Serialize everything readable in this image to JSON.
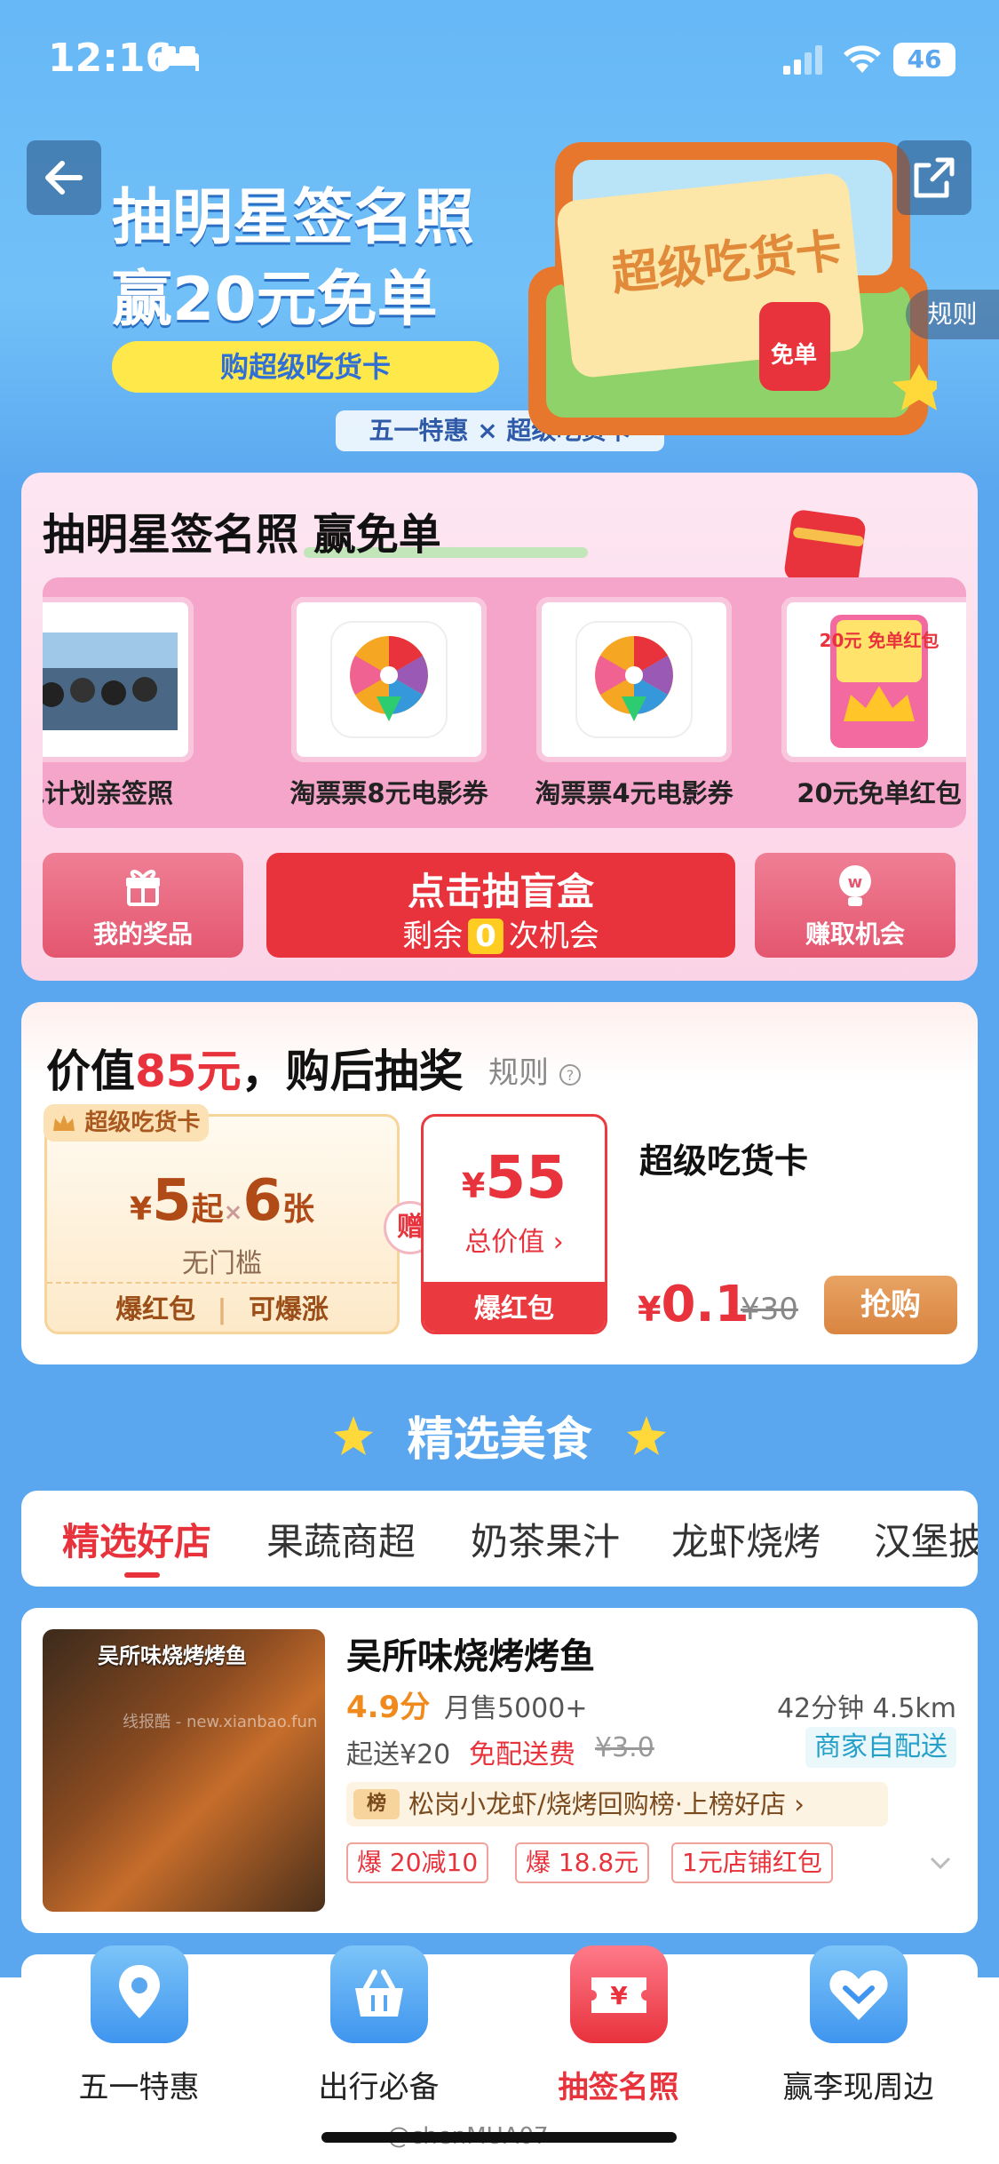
{
  "status_bar": {
    "time": "12:16",
    "battery": "46"
  },
  "hero": {
    "title_line1": "抽明星签名照",
    "title_line2": "赢20元免单",
    "pill": "购超级吃货卡",
    "tag": "五一特惠 × 超级吃货卡",
    "card_text": "超级吃货卡",
    "redbag_text": "免单",
    "rules": "规则"
  },
  "lottery": {
    "title": "抽明星签名照 赢免单",
    "prizes": [
      {
        "label": "跑计划亲签照"
      },
      {
        "label": "淘票票8元电影券"
      },
      {
        "label": "淘票票4元电影券"
      },
      {
        "label": "20元免单红包",
        "badge": "20元 免单红包"
      }
    ],
    "my_prizes": "我的奖品",
    "draw_title": "点击抽盲盒",
    "draw_remaining_prefix": "剩余",
    "draw_remaining_count": "0",
    "draw_remaining_suffix": "次机会",
    "earn": "赚取机会"
  },
  "value_card": {
    "head_prefix": "价值",
    "head_value": "85元",
    "head_suffix": "，购后抽奖",
    "rule": "规则",
    "coupon1": {
      "badge": "超级吃货卡",
      "currency": "¥",
      "from": "5",
      "from_suffix": "起",
      "times": "×",
      "count": "6",
      "count_suffix": "张",
      "threshold": "无门槛",
      "foot_left": "爆红包",
      "foot_right": "可爆涨"
    },
    "gift": "赠",
    "coupon2": {
      "currency": "¥",
      "amount": "55",
      "sub": "总价值",
      "foot": "爆红包"
    },
    "product_name": "超级吃货卡",
    "price_currency": "¥",
    "price_now": "0.1",
    "price_old": "¥30",
    "buy": "抢购"
  },
  "section_title": "精选美食",
  "tabs": [
    {
      "label": "精选好店",
      "active": true
    },
    {
      "label": "果蔬商超"
    },
    {
      "label": "奶茶果汁"
    },
    {
      "label": "龙虾烧烤"
    },
    {
      "label": "汉堡披"
    }
  ],
  "store": {
    "image_caption": "吴所味烧烤烤鱼",
    "image_watermark": "线报酷 - new.xianbao.fun",
    "name": "吴所味烧烤烤鱼",
    "score": "4.9分",
    "sales": "月售5000+",
    "distance": "42分钟 4.5km",
    "min_order": "起送¥20",
    "free_delivery": "免配送费",
    "old_fee": "¥3.0",
    "self_delivery": "商家自配送",
    "rank_badge": "榜",
    "rank_text": "松岗小龙虾/烧烤回购榜·上榜好店 ›",
    "promos": [
      "爆 20减10",
      "爆 18.8元",
      "1元店铺红包"
    ]
  },
  "bottom_nav": [
    {
      "label": "五一特惠",
      "icon": "map-pin-icon"
    },
    {
      "label": "出行必备",
      "icon": "basket-icon"
    },
    {
      "label": "抽签名照",
      "icon": "ticket-icon",
      "active": true
    },
    {
      "label": "赢李现周边",
      "icon": "heart-chevron-icon"
    }
  ],
  "watermark": "@chenMUA07",
  "colors": {
    "primary_red": "#e8323c",
    "sky_blue": "#5aa6ef",
    "gold": "#d98540"
  }
}
